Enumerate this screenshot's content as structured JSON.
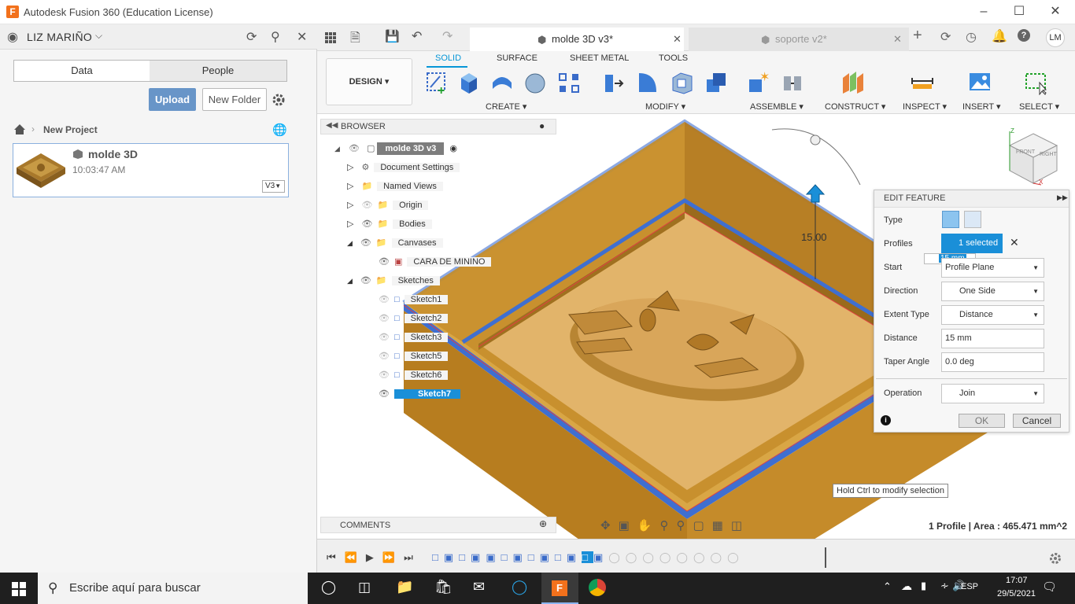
{
  "window": {
    "title": "Autodesk Fusion 360 (Education License)",
    "logo": "F"
  },
  "data_panel": {
    "user": "LIZ MARIÑO",
    "tabs": [
      "Data",
      "People"
    ],
    "upload_label": "Upload",
    "new_folder_label": "New Folder",
    "breadcrumb": "New Project",
    "file": {
      "name": "molde 3D",
      "time": "10:03:47 AM",
      "version": "V3"
    }
  },
  "doc_tabs": [
    {
      "label": "molde 3D v3*",
      "active": true
    },
    {
      "label": "soporte v2*",
      "active": false
    }
  ],
  "user_initials": "LM",
  "ribbon": {
    "workspace": "DESIGN",
    "tabs": [
      "SOLID",
      "SURFACE",
      "SHEET METAL",
      "TOOLS"
    ],
    "groups": [
      "CREATE",
      "MODIFY",
      "ASSEMBLE",
      "CONSTRUCT",
      "INSPECT",
      "INSERT",
      "SELECT"
    ]
  },
  "browser": {
    "title": "BROWSER",
    "root": "molde 3D v3",
    "items": [
      {
        "label": "Document Settings"
      },
      {
        "label": "Named Views"
      },
      {
        "label": "Origin"
      },
      {
        "label": "Bodies"
      },
      {
        "label": "Canvases"
      },
      {
        "label": "CARA DE MININO"
      },
      {
        "label": "Sketches"
      },
      {
        "label": "Sketch1"
      },
      {
        "label": "Sketch2"
      },
      {
        "label": "Sketch3"
      },
      {
        "label": "Sketch5"
      },
      {
        "label": "Sketch6"
      },
      {
        "label": "Sketch7"
      }
    ]
  },
  "comments_label": "COMMENTS",
  "viewport": {
    "dimension": "15.00",
    "hint": "Hold Ctrl to modify selection",
    "status": "1 Profile | Area : 465.471 mm^2",
    "inline_input": "15 mm"
  },
  "edit_feature": {
    "title": "EDIT FEATURE",
    "type_label": "Type",
    "profiles_label": "Profiles",
    "profiles_value": "1 selected",
    "start_label": "Start",
    "start_value": "Profile Plane",
    "direction_label": "Direction",
    "direction_value": "One Side",
    "extent_label": "Extent Type",
    "extent_value": "Distance",
    "distance_label": "Distance",
    "distance_value": "15 mm",
    "taper_label": "Taper Angle",
    "taper_value": "0.0 deg",
    "operation_label": "Operation",
    "operation_value": "Join",
    "ok_label": "OK",
    "cancel_label": "Cancel"
  },
  "taskbar": {
    "search_placeholder": "Escribe aquí para buscar",
    "lang": "ESP",
    "time": "17:07",
    "date": "29/5/2021"
  },
  "colors": {
    "accent": "#0696d7",
    "upload": "#6895c8",
    "model_wood": "#c8902e",
    "model_blue": "#3f6fd0"
  }
}
